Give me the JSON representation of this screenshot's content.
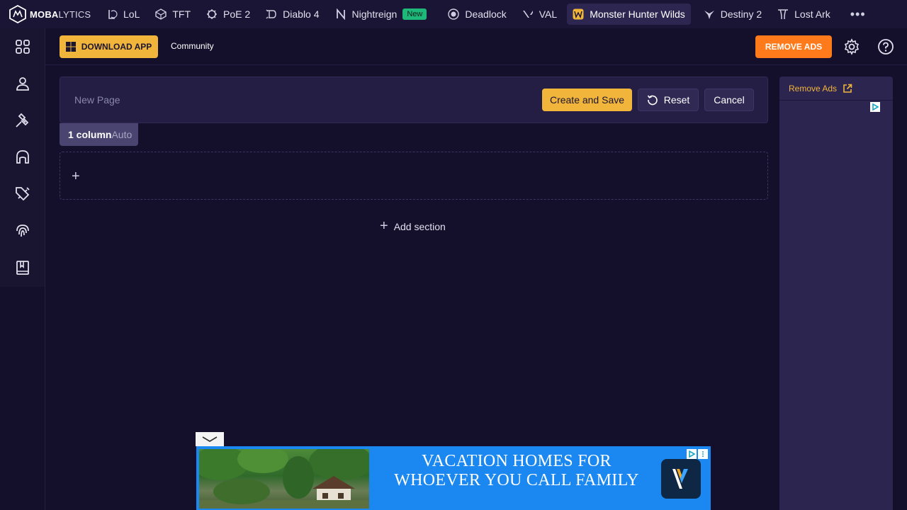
{
  "brand": {
    "name_bold": "MOBA",
    "name_light": "LYTICS"
  },
  "topnav": {
    "items": [
      {
        "label": "LoL",
        "icon": "lol-icon"
      },
      {
        "label": "TFT",
        "icon": "tft-icon"
      },
      {
        "label": "PoE 2",
        "icon": "poe2-icon"
      },
      {
        "label": "Diablo 4",
        "icon": "diablo4-icon"
      },
      {
        "label": "Nightreign",
        "icon": "nightreign-icon",
        "badge": "New"
      },
      {
        "label": "Deadlock",
        "icon": "deadlock-icon"
      },
      {
        "label": "VAL",
        "icon": "valorant-icon"
      },
      {
        "label": "Monster Hunter Wilds",
        "icon": "monster-hunter-icon",
        "active": true
      },
      {
        "label": "Destiny 2",
        "icon": "destiny2-icon"
      },
      {
        "label": "Lost Ark",
        "icon": "lost-ark-icon"
      }
    ],
    "more": "•••"
  },
  "sidebar": {
    "icons": [
      "grid-icon",
      "profile-icon",
      "hammer-icon",
      "helmet-icon",
      "sword-icon",
      "fingerprint-icon",
      "book-icon"
    ]
  },
  "subheader": {
    "download_label": "DOWNLOAD APP",
    "community_label": "Community",
    "remove_ads_label": "REMOVE ADS"
  },
  "editor": {
    "page_name_placeholder": "New Page",
    "create_label": "Create and Save",
    "reset_label": "Reset",
    "cancel_label": "Cancel",
    "columns_label": "1 column",
    "columns_mode": "Auto",
    "add_section_label": "Add section"
  },
  "ad_column": {
    "remove_ads_link": "Remove Ads"
  },
  "banner_ad": {
    "headline": "VACATION HOMES FOR WHOEVER YOU CALL FAMILY"
  },
  "colors": {
    "background": "#14102b",
    "accent_yellow": "#f2b53b",
    "accent_orange": "#ff7a1a",
    "badge_green": "#1db87a",
    "banner_blue": "#1b87f0"
  }
}
